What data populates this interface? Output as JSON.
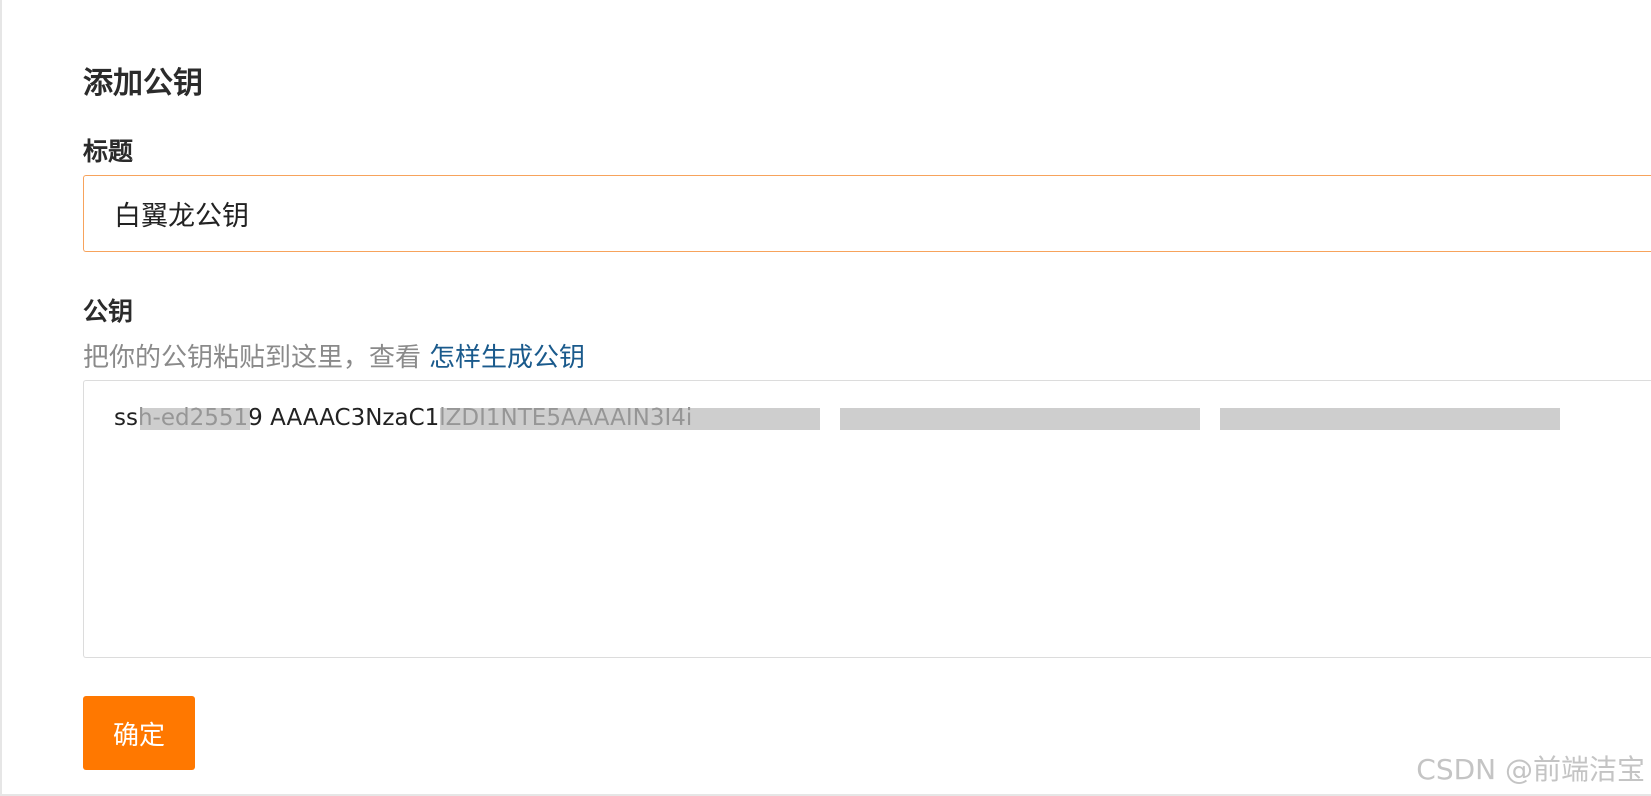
{
  "form": {
    "heading": "添加公钥",
    "title_label": "标题",
    "title_value": "白翼龙公钥",
    "key_label": "公钥",
    "key_hint": "把你的公钥粘贴到这里，查看",
    "key_hint_link": "怎样生成公钥",
    "key_value": "ssh-ed25519 AAAAC3NzaC1lZDI1NTE5AAAAIN3I4i",
    "submit_label": "确定"
  },
  "watermark": "CSDN @前端洁宝",
  "colors": {
    "accent": "#ff7800",
    "input_focus_border": "#f7a35c",
    "link": "#1a5a8c"
  }
}
